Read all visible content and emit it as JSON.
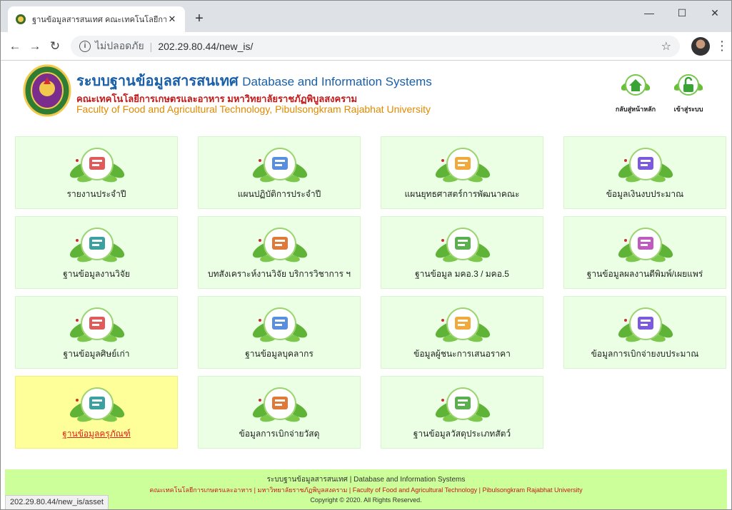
{
  "browser": {
    "tab_title": "ฐานข้อมูลสารสนเทศ คณะเทคโนโลยีการ",
    "security_label": "ไม่ปลอดภัย",
    "url": "202.29.80.44/new_is/",
    "status_url": "202.29.80.44/new_is/asset"
  },
  "header": {
    "title_th": "ระบบฐานข้อมูลสารสนเทศ",
    "title_en": "Database and Information Systems",
    "subtitle_th": "คณะเทคโนโลยีการเกษตรและอาหาร มหาวิทยาลัยราชภัฏพิบูลสงคราม",
    "subtitle_en": "Faculty of Food and Agricultural Technology, Pibulsongkram Rajabhat University",
    "home_label": "กลับสู่หน้าหลัก",
    "login_label": "เข้าสู่ระบบ"
  },
  "menu": [
    {
      "label": "รายงานประจำปี",
      "icon": "report-chart-icon"
    },
    {
      "label": "แผนปฏิบัติการประจำปี",
      "icon": "plan-meeting-icon"
    },
    {
      "label": "แผนยุทธศาสตร์การพัฒนาคณะ",
      "icon": "strategy-plan-icon"
    },
    {
      "label": "ข้อมูลเงินงบประมาณ",
      "icon": "budget-map-icon"
    },
    {
      "label": "ฐานข้อมูลงานวิจัย",
      "icon": "research-search-icon"
    },
    {
      "label": "บทสังเคราะห์งานวิจัย บริการวิชาการ ฯ",
      "icon": "presentation-icon"
    },
    {
      "label": "ฐานข้อมูล มคอ.3 / มคอ.5",
      "icon": "book-graduate-icon"
    },
    {
      "label": "ฐานข้อมูลผลงานตีพิมพ์/เผยแพร่",
      "icon": "publication-icon"
    },
    {
      "label": "ฐานข้อมูลศิษย์เก่า",
      "icon": "alumni-icon"
    },
    {
      "label": "ฐานข้อมูลบุคลากร",
      "icon": "person-icon"
    },
    {
      "label": "ข้อมูลผู้ชนะการเสนอราคา",
      "icon": "coin-hand-icon"
    },
    {
      "label": "ข้อมูลการเบิกจ่ายงบประมาณ",
      "icon": "money-chart-icon"
    },
    {
      "label": "ฐานข้อมูลครุภัณฑ์",
      "icon": "equipment-icon"
    },
    {
      "label": "ข้อมูลการเบิกจ่ายวัสดุ",
      "icon": "supplies-icon"
    },
    {
      "label": "ฐานข้อมูลวัสดุประเภทสัตว์",
      "icon": "livestock-icon"
    }
  ],
  "footer": {
    "line1": "ระบบฐานข้อมูลสารสนเทศ | Database and Information Systems",
    "line2": "คณะเทคโนโลยีการเกษตรและอาหาร | มหาวิทยาลัยราชภัฏพิบูลสงคราม | Faculty of Food and Agricultural Technology | Pibulsongkram Rajabhat University",
    "line3": "Copyright © 2020. All Rights Reserved."
  }
}
